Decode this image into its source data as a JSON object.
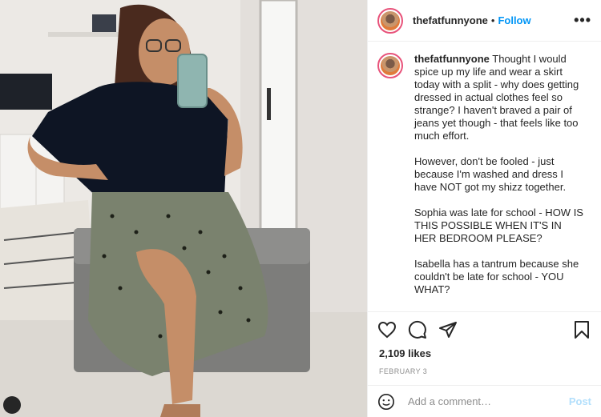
{
  "post": {
    "username": "thefatfunnyone",
    "dot": "•",
    "follow_label": "Follow",
    "more_label": "•••",
    "caption_user": "thefatfunnyone",
    "caption_text": " Thought I would spice up my life and wear a skirt today with a split - why does getting dressed in actual clothes feel so strange? I haven't braved a pair of jeans yet though - that feels like too much effort.\n\nHowever, don't be fooled - just because I'm washed and dress I have NOT got my shizz together.\n\nSophia was late for school - HOW IS THIS POSSIBLE WHEN IT'S IN HER BEDROOM PLEASE?\n\nIsabella has a tantrum because she couldn't be late for school - YOU WHAT?",
    "likes": "2,109 likes",
    "date": "FEBRUARY 3",
    "comment_placeholder": "Add a comment…",
    "post_label": "Post"
  },
  "icons": [
    "heart-icon",
    "comment-icon",
    "share-icon",
    "bookmark-icon",
    "emoji-icon",
    "account-icon"
  ],
  "colors": {
    "link": "#0095f6",
    "post_disabled": "#b2dffc",
    "muted": "#8e8e8e"
  }
}
